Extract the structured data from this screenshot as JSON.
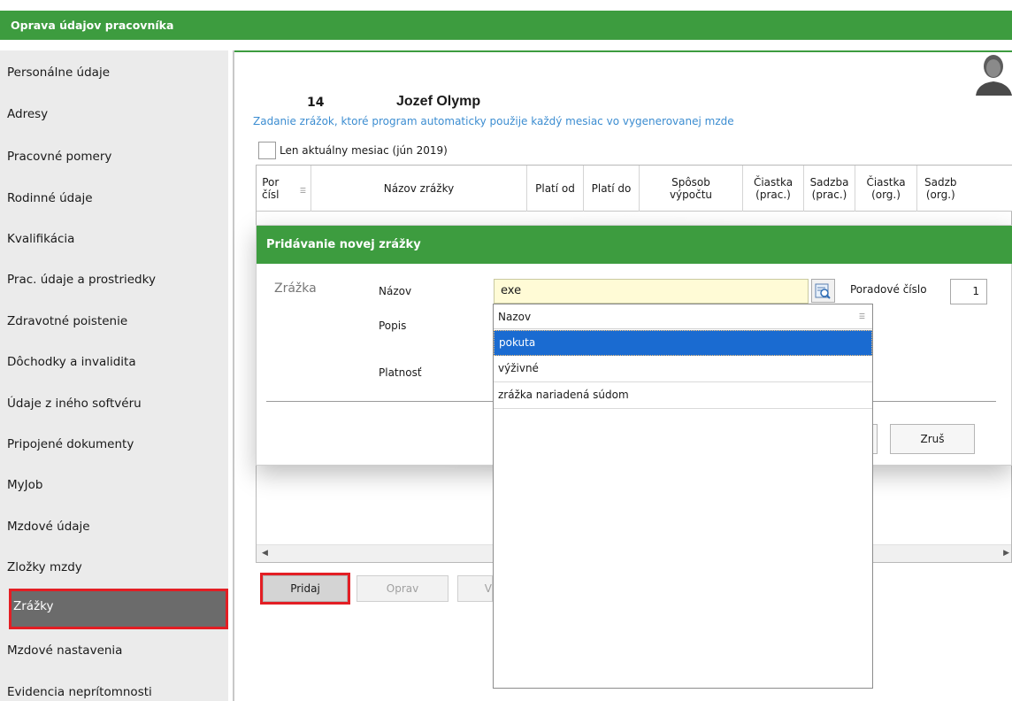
{
  "window": {
    "title": "Oprava údajov pracovníka"
  },
  "sidebar": {
    "items": [
      {
        "label": "Personálne údaje"
      },
      {
        "label": "Adresy"
      },
      {
        "label": "Pracovné pomery"
      },
      {
        "label": "Rodinné údaje"
      },
      {
        "label": "Kvalifikácia"
      },
      {
        "label": "Prac. údaje a prostriedky"
      },
      {
        "label": "Zdravotné poistenie"
      },
      {
        "label": "Dôchodky a invalidita"
      },
      {
        "label": "Údaje z iného softvéru"
      },
      {
        "label": "Pripojené dokumenty"
      },
      {
        "label": "MyJob"
      },
      {
        "label": "Mzdové údaje"
      },
      {
        "label": "Zložky mzdy"
      },
      {
        "label": "Zrážky"
      },
      {
        "label": "Mzdové nastavenia"
      },
      {
        "label": "Evidencia neprítomnosti"
      }
    ],
    "active_index": 13
  },
  "employee": {
    "number": "14",
    "name": "Jozef Olymp"
  },
  "info_text": "Zadanie zrážok, ktoré program automaticky použije každý mesiac vo vygenerovanej mzde",
  "filter": {
    "label": "Len aktuálny mesiac (jún 2019)",
    "checked": false
  },
  "grid": {
    "columns": [
      {
        "line1": "Por",
        "line2": "čísl"
      },
      {
        "line1": "Názov zrážky",
        "line2": ""
      },
      {
        "line1": "Platí od",
        "line2": ""
      },
      {
        "line1": "Platí do",
        "line2": ""
      },
      {
        "line1": "Spôsob",
        "line2": "výpočtu"
      },
      {
        "line1": "Čiastka",
        "line2": "(prac.)"
      },
      {
        "line1": "Sadzba",
        "line2": "(prac.)"
      },
      {
        "line1": "Čiastka",
        "line2": "(org.)"
      },
      {
        "line1": "Sadzb",
        "line2": "(org.)"
      }
    ]
  },
  "buttons": {
    "add": "Pridaj",
    "edit": "Oprav",
    "delete_partial": "V"
  },
  "dialog": {
    "title": "Pridávanie novej zrážky",
    "section": "Zrážka",
    "labels": {
      "name": "Názov",
      "description": "Popis",
      "validity": "Platnosť",
      "order": "Poradové číslo"
    },
    "name_value": "exe",
    "order_value": "1",
    "cancel": "Zruš"
  },
  "dropdown": {
    "header": "Nazov",
    "items": [
      {
        "label": "pokuta",
        "selected": true
      },
      {
        "label": "výživné",
        "selected": false
      },
      {
        "label": "zrážka nariadená súdom",
        "selected": false
      }
    ]
  },
  "colors": {
    "accent_green": "#3d9c3f",
    "highlight_red": "#e31e24",
    "selection_blue": "#1a6bd1",
    "info_blue": "#3c8dd1"
  }
}
